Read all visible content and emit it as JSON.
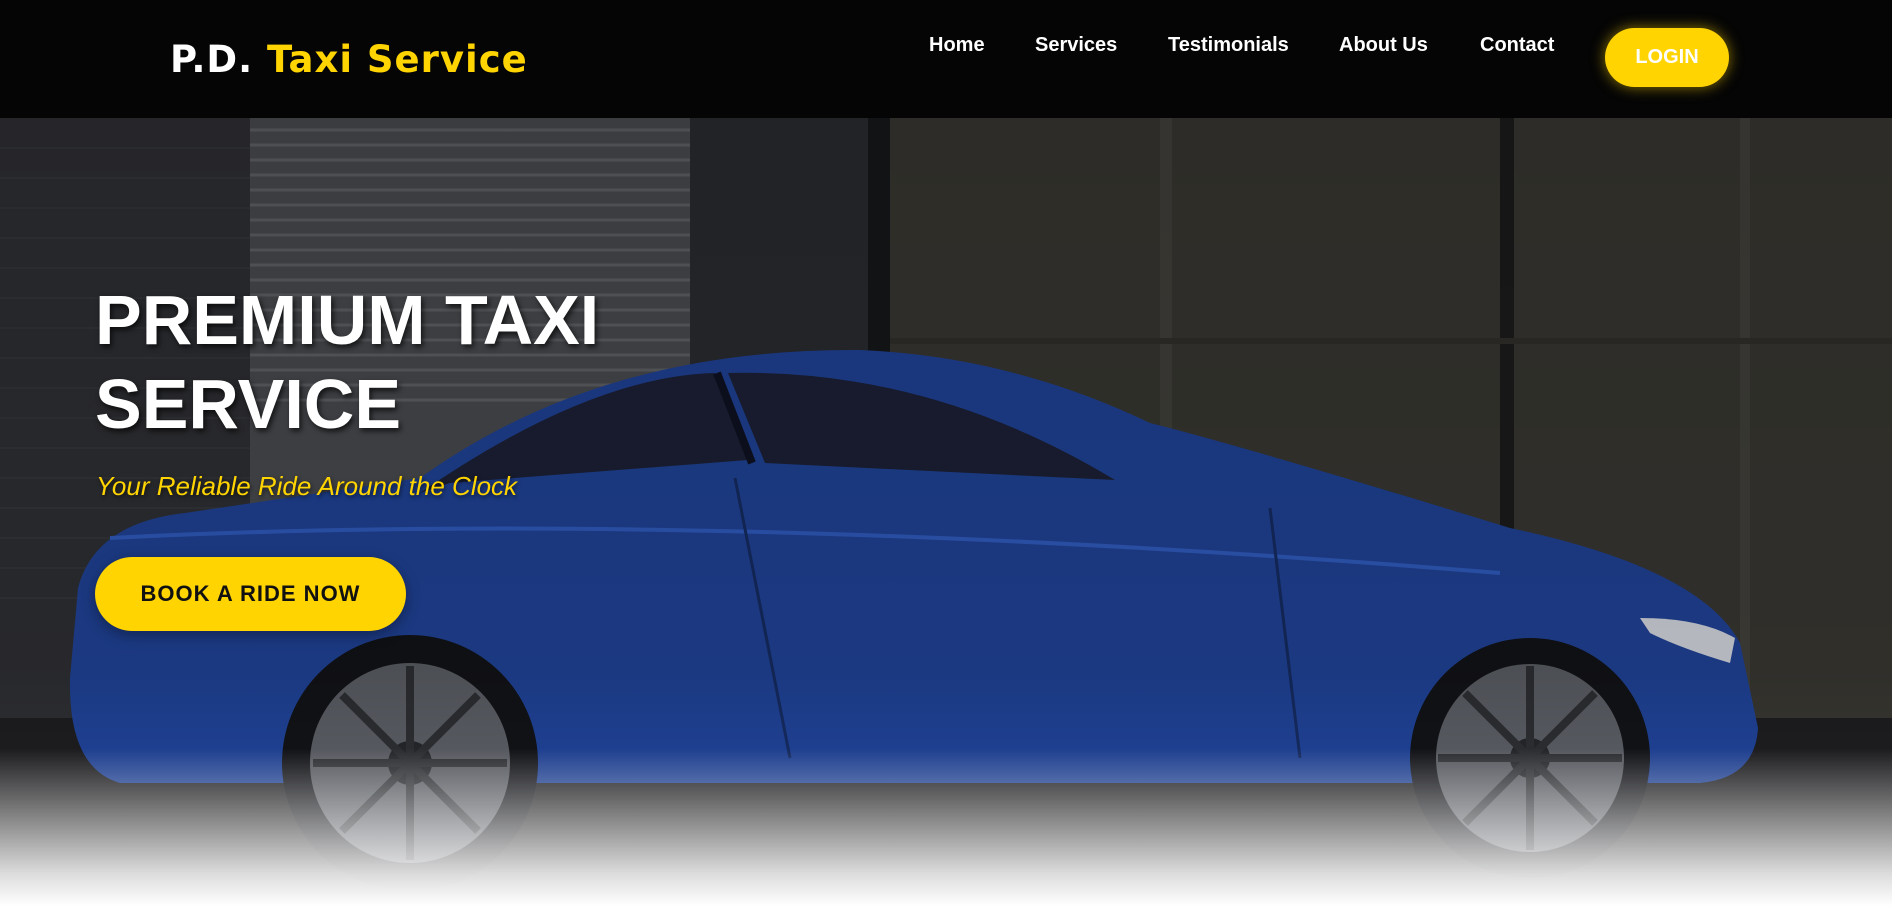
{
  "brand": {
    "prefix": "P.D.",
    "name": "Taxi Service"
  },
  "nav": {
    "items": [
      {
        "label": "Home"
      },
      {
        "label": "Services"
      },
      {
        "label": "Testimonials"
      },
      {
        "label": "About Us"
      },
      {
        "label": "Contact"
      }
    ],
    "login_label": "LOGIN"
  },
  "hero": {
    "title": "PREMIUM TAXI SERVICE",
    "subtitle": "Your Reliable Ride Around the Clock",
    "cta_label": "BOOK A RIDE NOW",
    "image_subject": "blue-coupe-car"
  },
  "colors": {
    "accent": "#ffd400",
    "navbar": "#050505",
    "text_light": "#ffffff",
    "car_body": "#1e3f8f"
  }
}
